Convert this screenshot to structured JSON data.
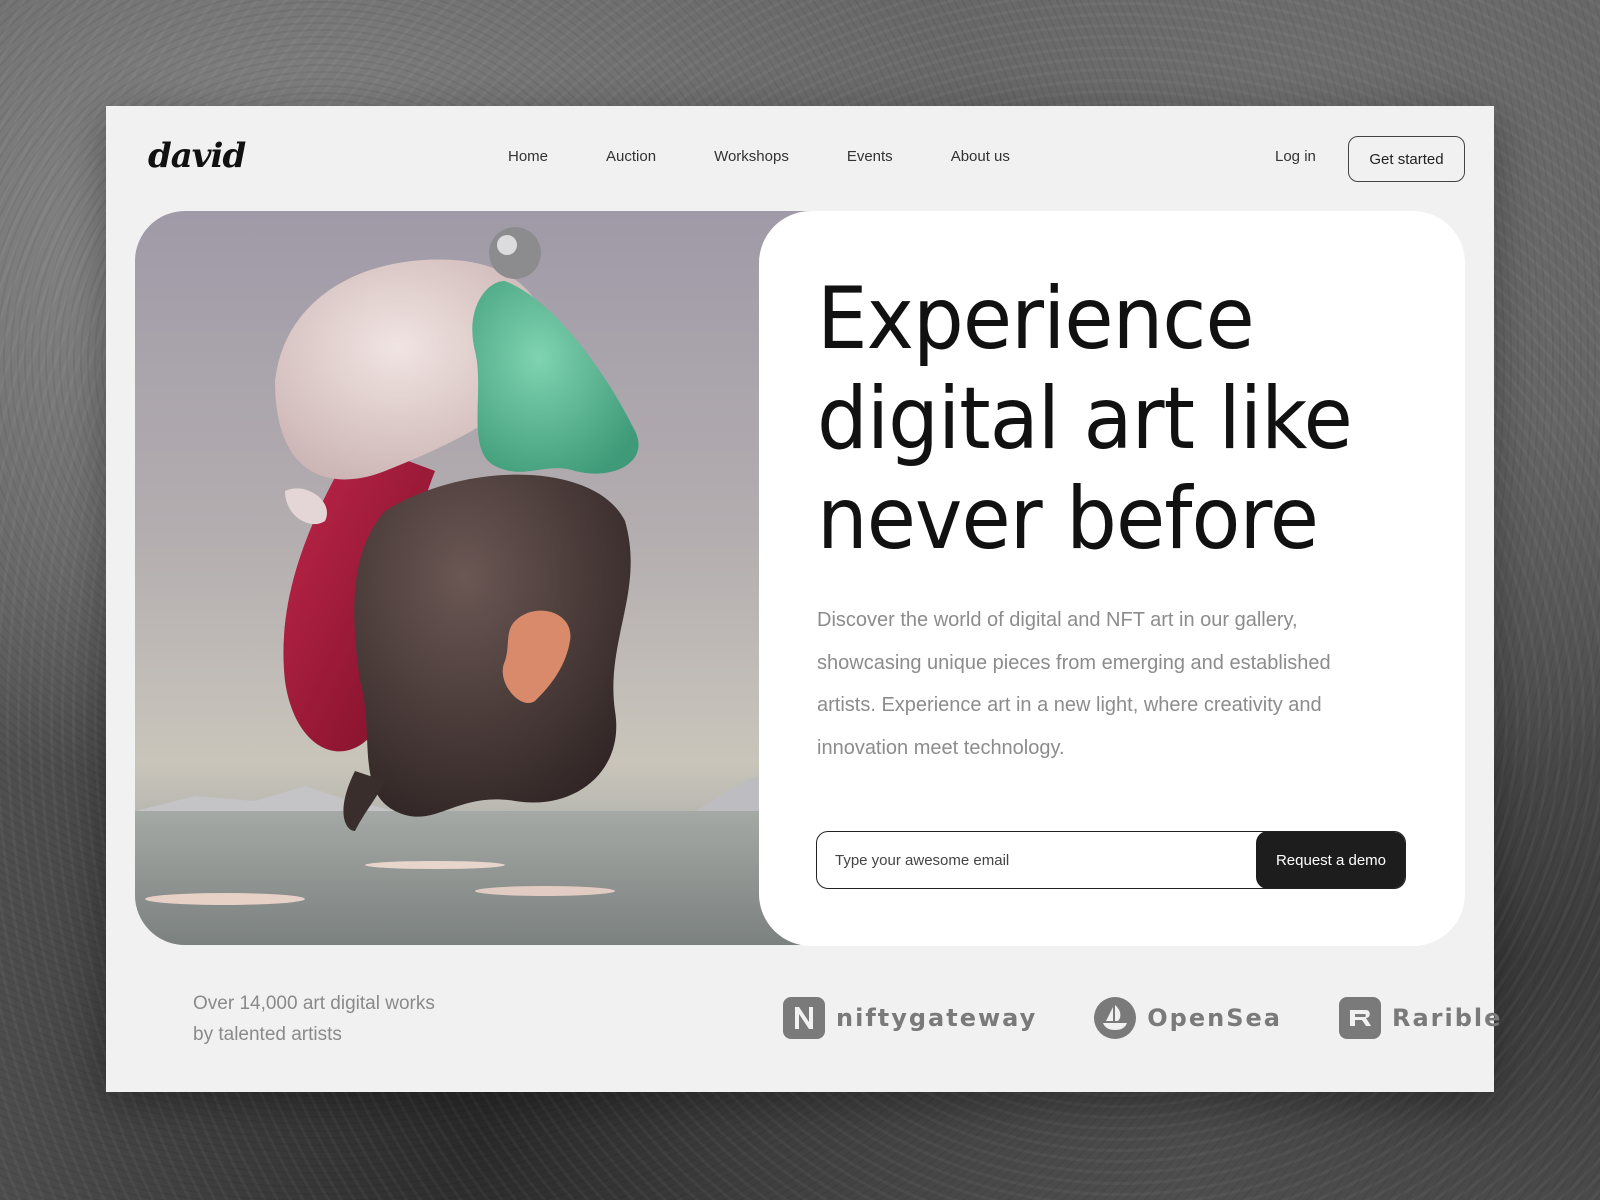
{
  "brand": {
    "logo": "david"
  },
  "nav": {
    "items": [
      "Home",
      "Auction",
      "Workshops",
      "Events",
      "About us"
    ],
    "login_label": "Log in",
    "get_started_label": "Get started"
  },
  "hero": {
    "headline_lines": [
      "Experience",
      "digital art like",
      "never before"
    ],
    "description": "Discover the world of digital and NFT art in our gallery, showcasing unique pieces from emerging and established artists. Experience art in a new light, where creativity and innovation meet technology.",
    "email_placeholder": "Type your awesome email",
    "email_value": "",
    "demo_button_label": "Request a demo"
  },
  "footer": {
    "stats_line1": "Over 14,000 art digital works",
    "stats_line2": "by talented artists",
    "partners": [
      {
        "name": "niftygateway",
        "icon": "niftygateway-icon"
      },
      {
        "name": "OpenSea",
        "icon": "opensea-icon"
      },
      {
        "name": "Rarible",
        "icon": "rarible-icon"
      }
    ]
  },
  "colors": {
    "card_bg": "#f1f1f1",
    "panel_bg": "#ffffff",
    "button_dark": "#1d1d1d",
    "muted_text": "#8c8c8c"
  }
}
